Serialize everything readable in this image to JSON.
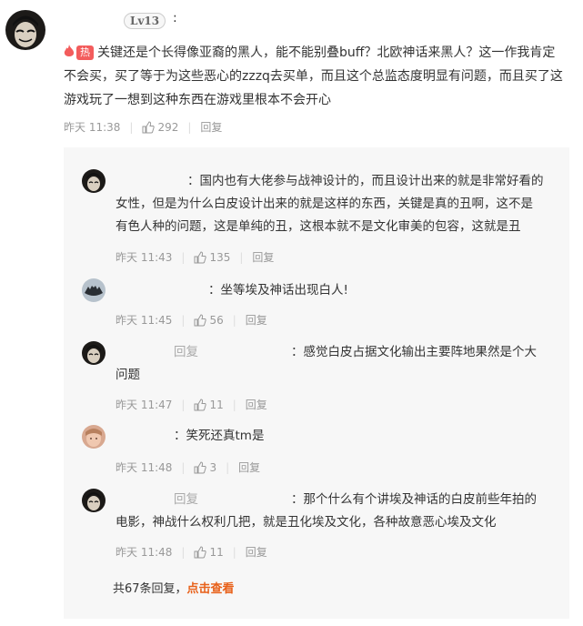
{
  "comment": {
    "level": "Lv13",
    "hot_label": "热",
    "text_lines": [
      "关键还是个长得像亚裔的黑人，能不能别叠buff？北欧神话来黑人？这一作我肯定",
      "不会买，买了等于为这些恶心的zzzq去买单，而且这个总监态度明显有问题，而且买了这",
      "游戏玩了一想到这种东西在游戏里根本不会开心"
    ],
    "time": "昨天 11:38",
    "likes": "292",
    "reply_label": "回复"
  },
  "replies": [
    {
      "lines": [
        "：国内也有大佬参与战神设计的，而且设计出来的就是非常好看的",
        "女性，但是为什么白皮设计出来的就是这样的东西，关键是真的丑啊，这不是",
        "有色人种的问题，这是单纯的丑，这根本就不是文化审美的包容，这就是丑"
      ],
      "time": "昨天 11:43",
      "likes": "135",
      "reply_label": "回复"
    },
    {
      "lines": [
        "：坐等埃及神话出现白人!"
      ],
      "time": "昨天 11:45",
      "likes": "56",
      "reply_label": "回复"
    },
    {
      "prefix": "回复",
      "lines": [
        "：感觉白皮占据文化输出主要阵地果然是个大",
        "问题"
      ],
      "time": "昨天 11:47",
      "likes": "11",
      "reply_label": "回复"
    },
    {
      "lines": [
        "：笑死还真tm是"
      ],
      "time": "昨天 11:48",
      "likes": "3",
      "reply_label": "回复"
    },
    {
      "prefix": "回复",
      "lines": [
        "：那个什么有个讲埃及神话的白皮前些年拍的",
        "电影，神战什么权利几把，就是丑化埃及文化，各种故意恶心埃及文化"
      ],
      "time": "昨天 11:48",
      "likes": "11",
      "reply_label": "回复"
    }
  ],
  "more": {
    "count_text": "共67条回复，",
    "link_text": "点击查看"
  },
  "colors": {
    "hot": "#f35c5c",
    "link": "#e8611a",
    "meta": "#999999",
    "reply_bg": "#f7f7f7"
  },
  "icons": [
    "avatar-mask",
    "avatar-batman",
    "avatar-doll",
    "flame-icon",
    "thumbs-up-icon"
  ]
}
